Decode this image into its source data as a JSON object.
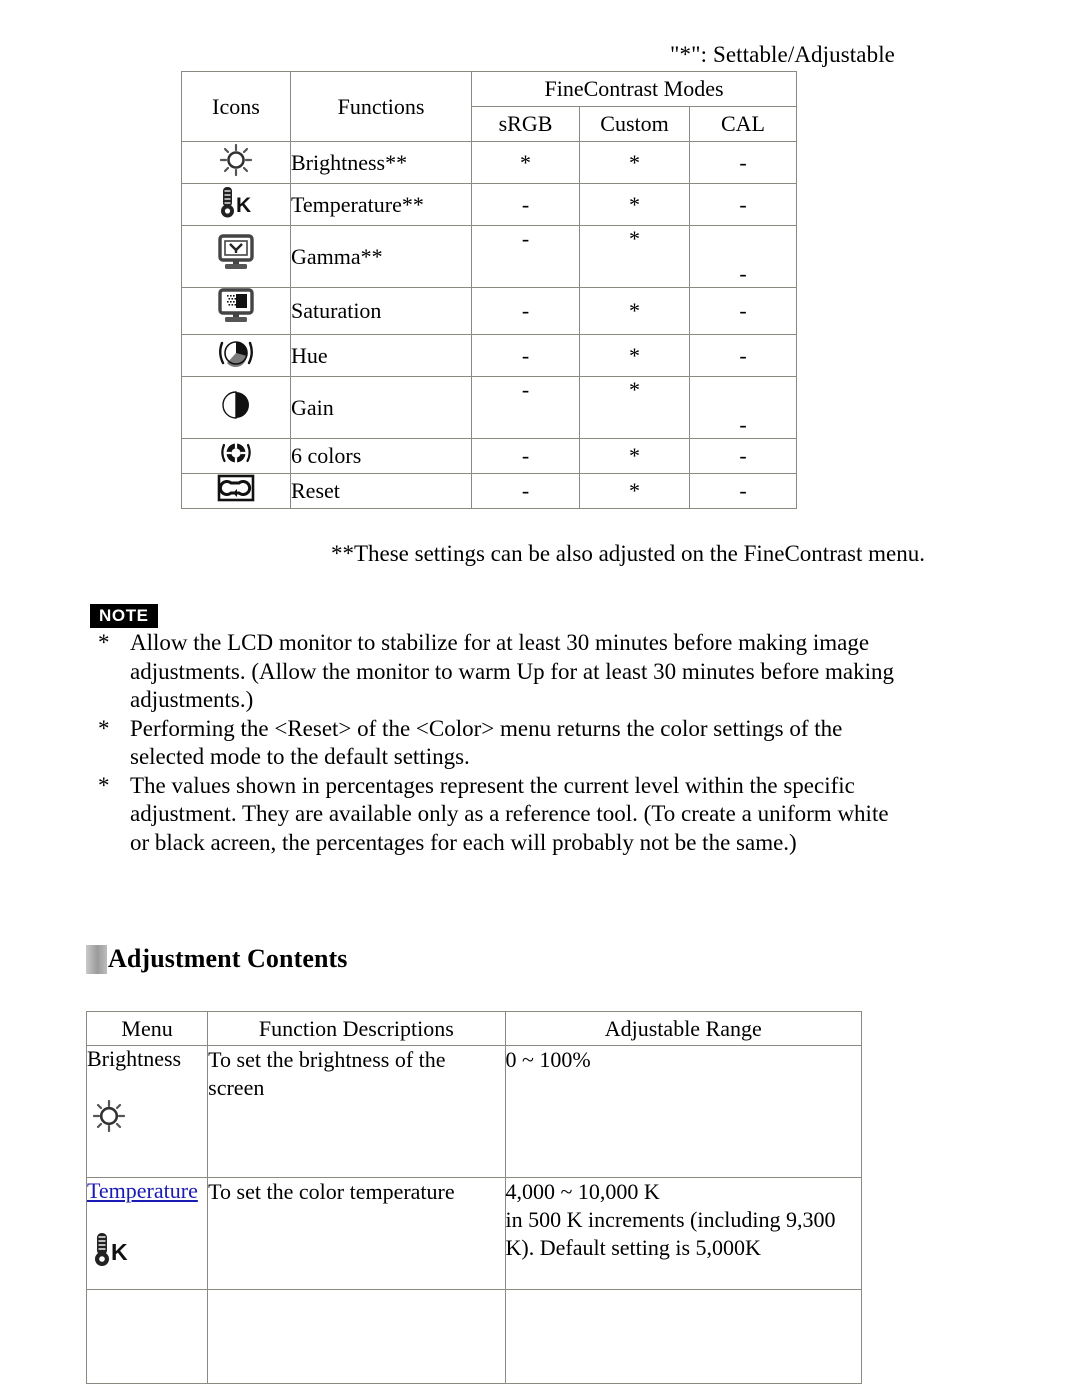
{
  "page": {
    "settable_caption": "\"*\": Settable/Adjustable",
    "footnote": "**These settings can be also adjusted on the FineContrast menu."
  },
  "modes_table": {
    "headers": {
      "icons": "Icons",
      "functions": "Functions",
      "group": "FineContrast Modes",
      "srgb": "sRGB",
      "custom": "Custom",
      "cal": "CAL"
    },
    "rows": [
      {
        "icon": "sun-icon",
        "function": "Brightness**",
        "srgb": "*",
        "custom": "*",
        "cal": "-"
      },
      {
        "icon": "thermometer-k-icon",
        "function": "Temperature**",
        "srgb": "-",
        "custom": "*",
        "cal": "-"
      },
      {
        "icon": "monitor-gamma-icon",
        "function": "Gamma**",
        "srgb": "-",
        "custom": "*",
        "cal": "-"
      },
      {
        "icon": "monitor-saturation-icon",
        "function": "Saturation",
        "srgb": "-",
        "custom": "*",
        "cal": "-"
      },
      {
        "icon": "hue-wheel-icon",
        "function": "Hue",
        "srgb": "-",
        "custom": "*",
        "cal": "-"
      },
      {
        "icon": "gain-contrast-icon",
        "function": "Gain",
        "srgb": "-",
        "custom": "*",
        "cal": "-"
      },
      {
        "icon": "six-colors-icon",
        "function": "6 colors",
        "srgb": "-",
        "custom": "*",
        "cal": "-"
      },
      {
        "icon": "reset-loop-icon",
        "function": "Reset",
        "srgb": "-",
        "custom": "*",
        "cal": "-"
      }
    ]
  },
  "note": {
    "badge": "NOTE",
    "bullet": "*",
    "items": [
      "Allow the LCD monitor to stabilize for at least 30 minutes before making image adjustments. (Allow the monitor to warm Up for at least 30 minutes before making adjustments.)",
      "Performing the <Reset> of the <Color> menu returns the color settings of the selected mode to the default settings.",
      "The values shown in percentages represent the current level within the specific adjustment. They are available only as a reference tool. (To create a uniform white or black acreen, the percentages for each will probably not be the same.)"
    ]
  },
  "section": {
    "heading": "Adjustment Contents"
  },
  "adjust_table": {
    "headers": {
      "menu": "Menu",
      "description": "Function Descriptions",
      "range": "Adjustable Range"
    },
    "rows": [
      {
        "menu": "Brightness",
        "menu_is_link": false,
        "icon": "sun-icon",
        "description": "To set the brightness of the screen",
        "range": "0 ~ 100%"
      },
      {
        "menu": "Temperature",
        "menu_is_link": true,
        "icon": "thermometer-k-icon",
        "description": "To set the color temperature",
        "range": "4,000 ~ 10,000 K\nin 500 K increments (including 9,300 K). Default setting is 5,000K"
      }
    ]
  },
  "colors": {
    "link": "#1a1ab4",
    "border": "#8a8a82",
    "note_badge_bg": "#000000",
    "heading_marker": "#9b9b9b"
  }
}
